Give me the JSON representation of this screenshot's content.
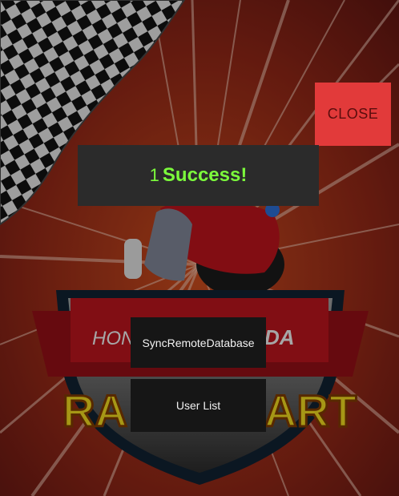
{
  "dialog": {
    "close_label": "CLOSE"
  },
  "toast": {
    "count": "1",
    "message": "Success!"
  },
  "menu": {
    "sync_label": "SyncRemoteDatabase",
    "user_list_label": "User List"
  },
  "background": {
    "logo_text_left": "RA",
    "logo_text_right": "ART",
    "brand_text": "DA"
  },
  "colors": {
    "close": "#e23a3a",
    "toast_text": "#7cfc3c",
    "button_bg": "#161616"
  }
}
